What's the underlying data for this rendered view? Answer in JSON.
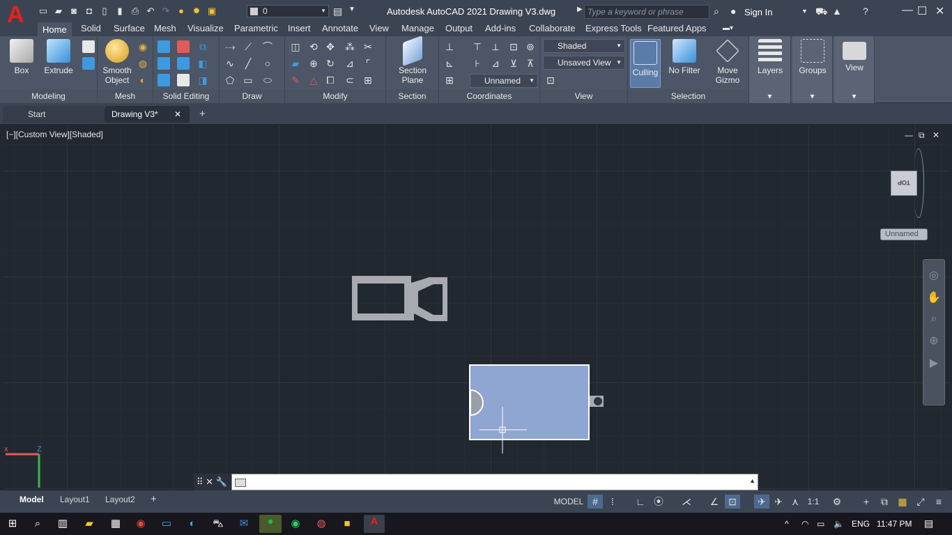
{
  "app": {
    "title": "Autodesk AutoCAD 2021   Drawing V3.dwg",
    "logo_letter": "A",
    "accent": "#e2231a"
  },
  "quick_access": {
    "layer_current": "0",
    "icons": [
      "new-icon",
      "open-icon",
      "save-icon",
      "save-as-icon",
      "open-web-icon",
      "save-web-icon",
      "plot-icon",
      "undo-icon",
      "redo-icon"
    ]
  },
  "search": {
    "placeholder": "Type a keyword or phrase"
  },
  "account": {
    "sign_in": "Sign In"
  },
  "ribbon_tabs": [
    "Home",
    "Solid",
    "Surface",
    "Mesh",
    "Visualize",
    "Parametric",
    "Insert",
    "Annotate",
    "View",
    "Manage",
    "Output",
    "Add-ins",
    "Collaborate",
    "Express Tools",
    "Featured Apps"
  ],
  "ribbon": {
    "modeling": {
      "title": "Modeling",
      "box": "Box",
      "extrude": "Extrude"
    },
    "mesh": {
      "title": "Mesh",
      "smooth1": "Smooth",
      "smooth2": "Object"
    },
    "solid_editing": {
      "title": "Solid Editing"
    },
    "draw": {
      "title": "Draw"
    },
    "modify": {
      "title": "Modify"
    },
    "section": {
      "title": "Section",
      "btn1": "Section",
      "btn2": "Plane"
    },
    "coordinates": {
      "title": "Coordinates",
      "ucs": "Unnamed"
    },
    "view": {
      "title": "View",
      "visual_style": "Shaded",
      "named_view": "Unsaved View"
    },
    "selection": {
      "title": "Selection",
      "culling": "Culling",
      "no_filter": "No Filter",
      "move1": "Move",
      "move2": "Gizmo"
    },
    "layers": "Layers",
    "groups": "Groups",
    "view_panel": "View"
  },
  "doc_tabs": {
    "start": "Start",
    "drawing": "Drawing V3*"
  },
  "viewport": {
    "label": "[−][Custom View][Shaded]",
    "viewcube_face": "TOP",
    "ucs_name": "Unnamed",
    "shape_color": "#8ea6d1"
  },
  "layout_tabs": [
    "Model",
    "Layout1",
    "Layout2"
  ],
  "status": {
    "model": "MODEL",
    "scale": "1:1"
  },
  "tray": {
    "lang": "ENG",
    "time": "11:47 PM"
  }
}
